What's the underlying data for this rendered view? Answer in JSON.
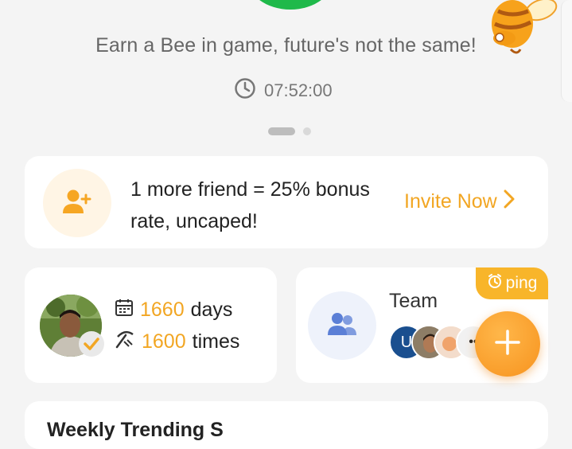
{
  "header": {
    "tagline": "Earn a Bee in game, future's not the same!",
    "timer": "07:52:00",
    "timer_icon": "clock-icon",
    "bee_icon": "bee-mascot-icon"
  },
  "carousel": {
    "pages": 2,
    "active_index": 0
  },
  "invite": {
    "icon": "add-user-icon",
    "line1": "1 more friend = 25% bonus",
    "line2": "rate, uncaped!",
    "link_label": "Invite Now"
  },
  "stats": {
    "days_value": "1660",
    "days_unit": "days",
    "times_value": "1600",
    "times_unit": "times",
    "calendar_icon": "calendar-icon",
    "pickaxe_icon": "pickaxe-icon"
  },
  "team": {
    "title": "Team",
    "ping_label": "ping",
    "first_member_initial": "U",
    "more_indicator": "••",
    "icon": "team-icon"
  },
  "fab": {
    "icon": "plus-icon"
  },
  "bottom_section": {
    "title": "Weekly Trending S"
  },
  "colors": {
    "accent": "#f2a623",
    "green": "#1fb94a",
    "team_icon": "#5b7fd6"
  }
}
